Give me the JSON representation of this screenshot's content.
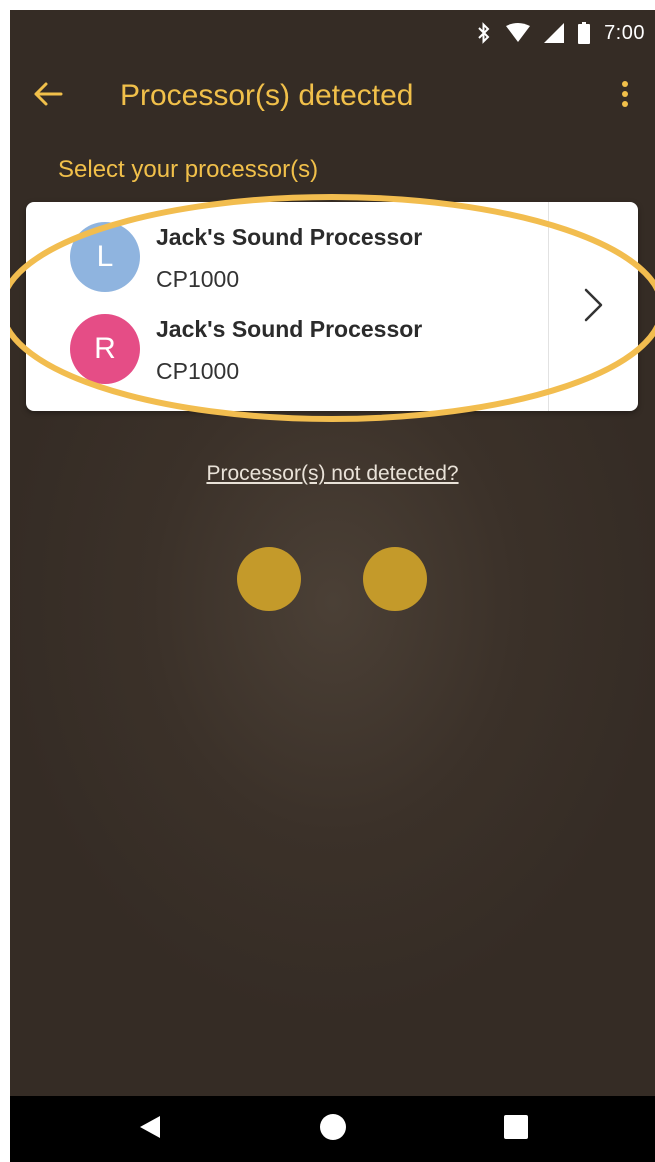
{
  "status_bar": {
    "time": "7:00",
    "icons": [
      "bluetooth-icon",
      "wifi-icon",
      "signal-icon",
      "battery-icon"
    ]
  },
  "app_bar": {
    "title": "Processor(s) detected",
    "back_icon": "arrow-left-icon",
    "menu_icon": "more-vertical-icon"
  },
  "section_label": "Select your processor(s)",
  "processors": [
    {
      "avatar_letter": "L",
      "avatar_color": "#8fb4df",
      "name": "Jack's Sound Processor",
      "model": "CP1000"
    },
    {
      "avatar_letter": "R",
      "avatar_color": "#e54d86",
      "name": "Jack's Sound Processor",
      "model": "CP1000"
    }
  ],
  "not_detected_link": "Processor(s) not detected?",
  "loading_dots": 2,
  "colors": {
    "accent": "#f1c04a",
    "background": "#3b3129",
    "dot": "#c49a2a",
    "highlight_ring": "#f2bd4f"
  },
  "nav_bar": {
    "icons": [
      "back-triangle-icon",
      "home-circle-icon",
      "recents-square-icon"
    ]
  }
}
